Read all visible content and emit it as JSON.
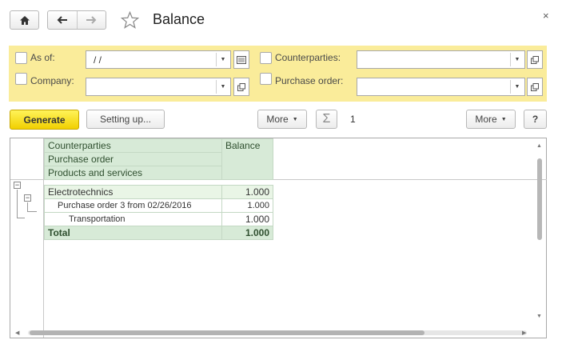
{
  "header": {
    "title": "Balance",
    "close_glyph": "×"
  },
  "filters": {
    "as_of": {
      "label": "As of:",
      "value": " /  /"
    },
    "company": {
      "label": "Company:",
      "value": ""
    },
    "counterparties": {
      "label": "Counterparties:",
      "value": ""
    },
    "purchase_order": {
      "label": "Purchase order:",
      "value": ""
    }
  },
  "toolbar": {
    "generate_label": "Generate",
    "setting_up_label": "Setting up...",
    "more_label_1": "More",
    "sum_glyph": "Σ",
    "sum_value": "1",
    "more_label_2": "More",
    "help_label": "?"
  },
  "report": {
    "headers": [
      "Counterparties",
      "Purchase order",
      "Products and services"
    ],
    "balance_header": "Balance",
    "rows": [
      {
        "label": "Electrotechnics",
        "value": "1.000"
      },
      {
        "label": "Purchase order 3 from 02/26/2016",
        "value": "1.000"
      },
      {
        "label": "Transportation",
        "value": "1.000"
      }
    ],
    "total": {
      "label": "Total",
      "value": "1.000"
    }
  },
  "colors": {
    "filter_bg": "#faec9a",
    "generate_bg": "#f7df1e",
    "header_green": "#d7ead7"
  }
}
